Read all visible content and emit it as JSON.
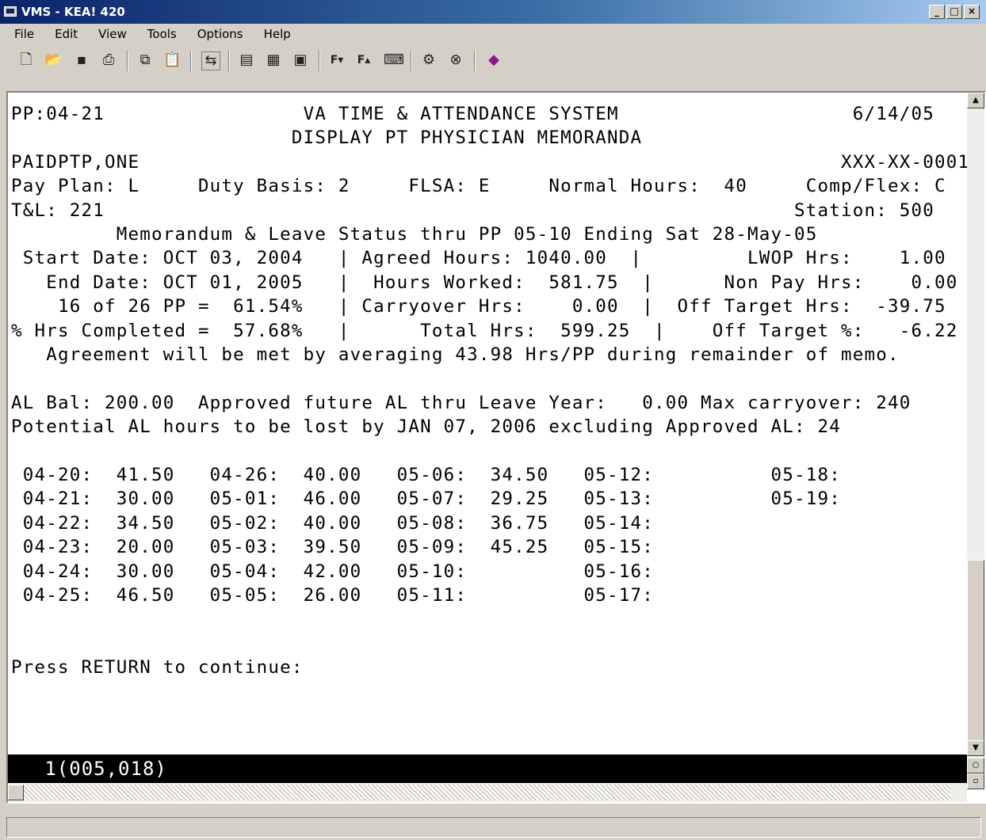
{
  "window": {
    "title": "VMS - KEA! 420"
  },
  "menu": [
    "File",
    "Edit",
    "View",
    "Tools",
    "Options",
    "Help"
  ],
  "toolbar_icons": [
    "new-icon",
    "open-icon",
    "save-icon",
    "print-icon",
    "copy-icon",
    "paste-icon",
    "connect-icon",
    "folder-a-icon",
    "folder-b-icon",
    "folder-c-icon",
    "font-a-icon",
    "font-b-icon",
    "keyboard-icon",
    "settings-icon",
    "stop-icon",
    "book-icon"
  ],
  "screen": {
    "lines": [
      "PP:04-21                 VA TIME & ATTENDANCE SYSTEM                    6/14/05",
      "                        DISPLAY PT PHYSICIAN MEMORANDA",
      "PAIDPTP,ONE                                                            XXX-XX-0001",
      "Pay Plan: L     Duty Basis: 2     FLSA: E     Normal Hours:  40     Comp/Flex: C",
      "T&L: 221                                                           Station: 500",
      "         Memorandum & Leave Status thru PP 05-10 Ending Sat 28-May-05",
      " Start Date: OCT 03, 2004   | Agreed Hours: 1040.00  |         LWOP Hrs:    1.00",
      "   End Date: OCT 01, 2005   |  Hours Worked:  581.75  |      Non Pay Hrs:    0.00",
      "    16 of 26 PP =  61.54%   | Carryover Hrs:    0.00  |  Off Target Hrs:  -39.75",
      "% Hrs Completed =  57.68%   |      Total Hrs:  599.25  |    Off Target %:   -6.22",
      "   Agreement will be met by averaging 43.98 Hrs/PP during remainder of memo.",
      "",
      "AL Bal: 200.00  Approved future AL thru Leave Year:   0.00 Max carryover: 240",
      "Potential AL hours to be lost by JAN 07, 2006 excluding Approved AL: 24",
      "",
      " 04-20:  41.50   04-26:  40.00   05-06:  34.50   05-12:          05-18:",
      " 04-21:  30.00   05-01:  46.00   05-07:  29.25   05-13:          05-19:",
      " 04-22:  34.50   05-02:  40.00   05-08:  36.75   05-14:",
      " 04-23:  20.00   05-03:  39.50   05-09:  45.25   05-15:",
      " 04-24:  30.00   05-04:  42.00   05-10:          05-16:",
      " 04-25:  46.50   05-05:  26.00   05-11:          05-17:",
      "",
      "",
      "Press RETURN to continue:"
    ],
    "status_line": "   1(005,018)"
  }
}
